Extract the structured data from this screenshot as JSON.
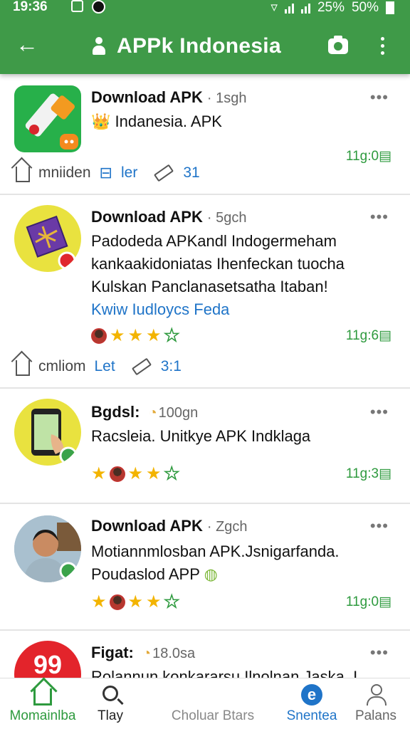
{
  "status": {
    "time": "19:36",
    "wifi": "▿",
    "battery_a": "25%",
    "battery_b": "50%"
  },
  "appbar": {
    "back": "←",
    "title": "APPk Indonesia"
  },
  "cards": [
    {
      "title": "Download APK",
      "time": "· 1sgh",
      "more": "•••",
      "lines": [
        "👑 Indanesia. APK"
      ],
      "stamp": "11g:0▤",
      "actions": {
        "save": "mniiden",
        "share": "ler",
        "count": "31"
      }
    },
    {
      "title": "Download APK",
      "time": "· 5gch",
      "more": "•••",
      "lines": [
        "Padodeda APKandl Indogermeham",
        "kankaakidoniatas Ihenfeckan tuocha",
        "Kulskan Panclanasetsatha Itaban!"
      ],
      "link": "Kwiw Iudloycs Feda",
      "stamp": "11g:6▤",
      "actions": {
        "save": "cmliom",
        "share": "Let",
        "count": "3:1"
      }
    },
    {
      "title": "Bgdsl:",
      "time": "100gn",
      "more": "•••",
      "lines": [
        "Racsleia. Unitkye APK Indklaga"
      ],
      "stamp": "11g:3▤"
    },
    {
      "title": "Download APK",
      "time": "· Zgch",
      "more": "•••",
      "lines": [
        "Motiannmlosban APK.Jsnigarfanda.",
        "Poudaslod APP"
      ],
      "stamp": "11g:0▤"
    },
    {
      "title": "Figat:",
      "time": "18.0sa",
      "more": "•••",
      "badge": "99",
      "lines": [
        "Rolannun konkararsu Ilnolnan Jaska. I"
      ]
    }
  ],
  "nav": [
    {
      "label": "Momainlba"
    },
    {
      "label": "Tlay"
    },
    {
      "label": "Choluar Btars"
    },
    {
      "label": "Snentea"
    },
    {
      "label": "Palans"
    }
  ],
  "colors": {
    "accent": "#3f9a48",
    "link": "#1f74c8",
    "star": "#f3b400"
  }
}
